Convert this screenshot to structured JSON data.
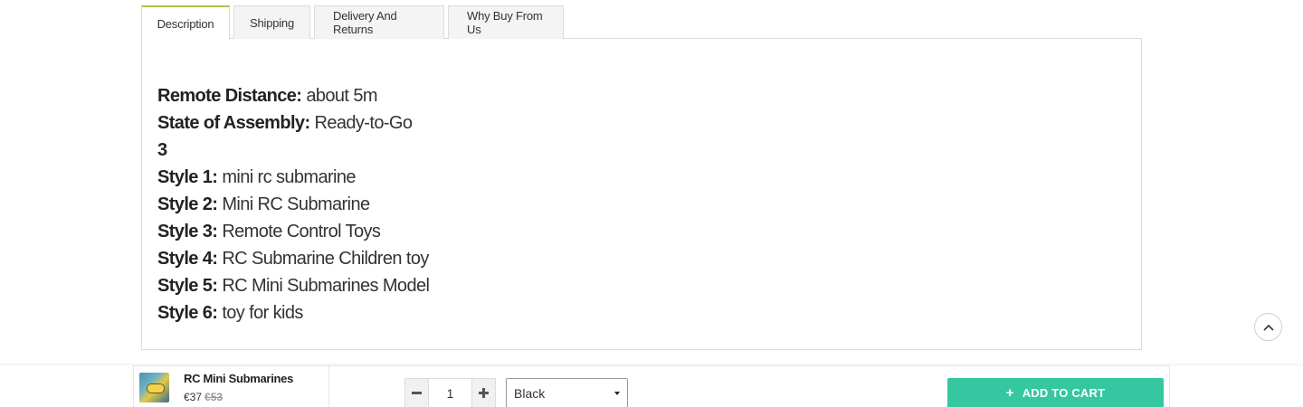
{
  "tabs": [
    {
      "label": "Description"
    },
    {
      "label": "Shipping"
    },
    {
      "label": "Delivery And Returns"
    },
    {
      "label": "Why Buy From Us"
    }
  ],
  "active_tab": "Description",
  "specs": [
    {
      "key": "Remote Distance:",
      "value": "about 5m"
    },
    {
      "key": "State of Assembly:",
      "value": "Ready-to-Go"
    },
    {
      "key": "3",
      "value": ""
    },
    {
      "key": "Style 1:",
      "value": "mini rc submarine"
    },
    {
      "key": "Style 2:",
      "value": "Mini RC Submarine"
    },
    {
      "key": "Style 3:",
      "value": "Remote Control Toys"
    },
    {
      "key": "Style 4:",
      "value": "RC Submarine Children toy"
    },
    {
      "key": "Style 5:",
      "value": "RC Mini Submarines Model"
    },
    {
      "key": "Style 6:",
      "value": "toy for kids"
    }
  ],
  "sticky_bar": {
    "product_name": "RC Mini Submarines",
    "price": "€37",
    "compare_price": "€53",
    "quantity": "1",
    "variant": "Black",
    "add_to_cart_label": "ADD TO CART"
  },
  "colors": {
    "active_tab_accent": "#a7c44a",
    "add_to_cart_bg": "#35c7a0"
  },
  "icons": [
    "minus-icon",
    "plus-icon",
    "chevron-up-icon",
    "caret-down-icon",
    "product-thumbnail"
  ]
}
